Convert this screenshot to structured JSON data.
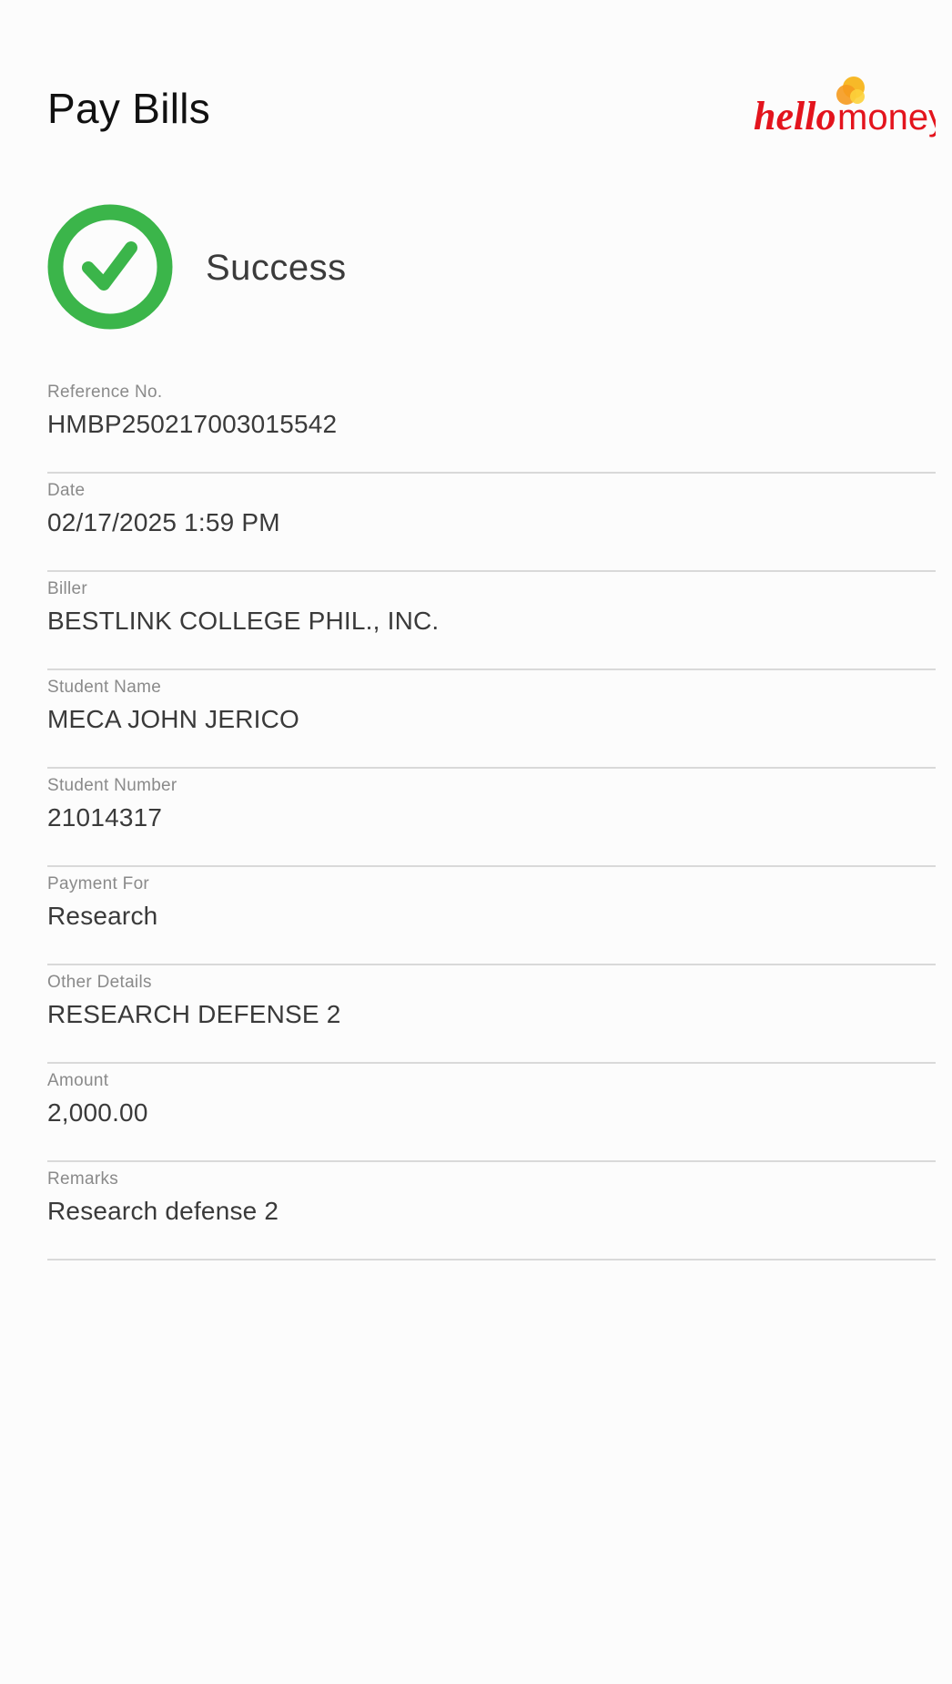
{
  "header": {
    "title": "Pay Bills",
    "logo_text_a": "hello",
    "logo_text_b": "money"
  },
  "status": {
    "text": "Success",
    "icon": "check-circle-icon",
    "color": "#3bb54a"
  },
  "brand": {
    "red": "#e3141d",
    "yellow": "#f7b51c"
  },
  "fields": [
    {
      "label": "Reference No.",
      "value": "HMBP250217003015542"
    },
    {
      "label": "Date",
      "value": "02/17/2025 1:59 PM"
    },
    {
      "label": "Biller",
      "value": "BESTLINK COLLEGE PHIL., INC."
    },
    {
      "label": "Student Name",
      "value": "MECA JOHN JERICO"
    },
    {
      "label": "Student Number",
      "value": "21014317"
    },
    {
      "label": "Payment For",
      "value": "Research"
    },
    {
      "label": "Other Details",
      "value": "RESEARCH DEFENSE 2"
    },
    {
      "label": "Amount",
      "value": "2,000.00"
    },
    {
      "label": "Remarks",
      "value": "Research defense 2"
    }
  ]
}
